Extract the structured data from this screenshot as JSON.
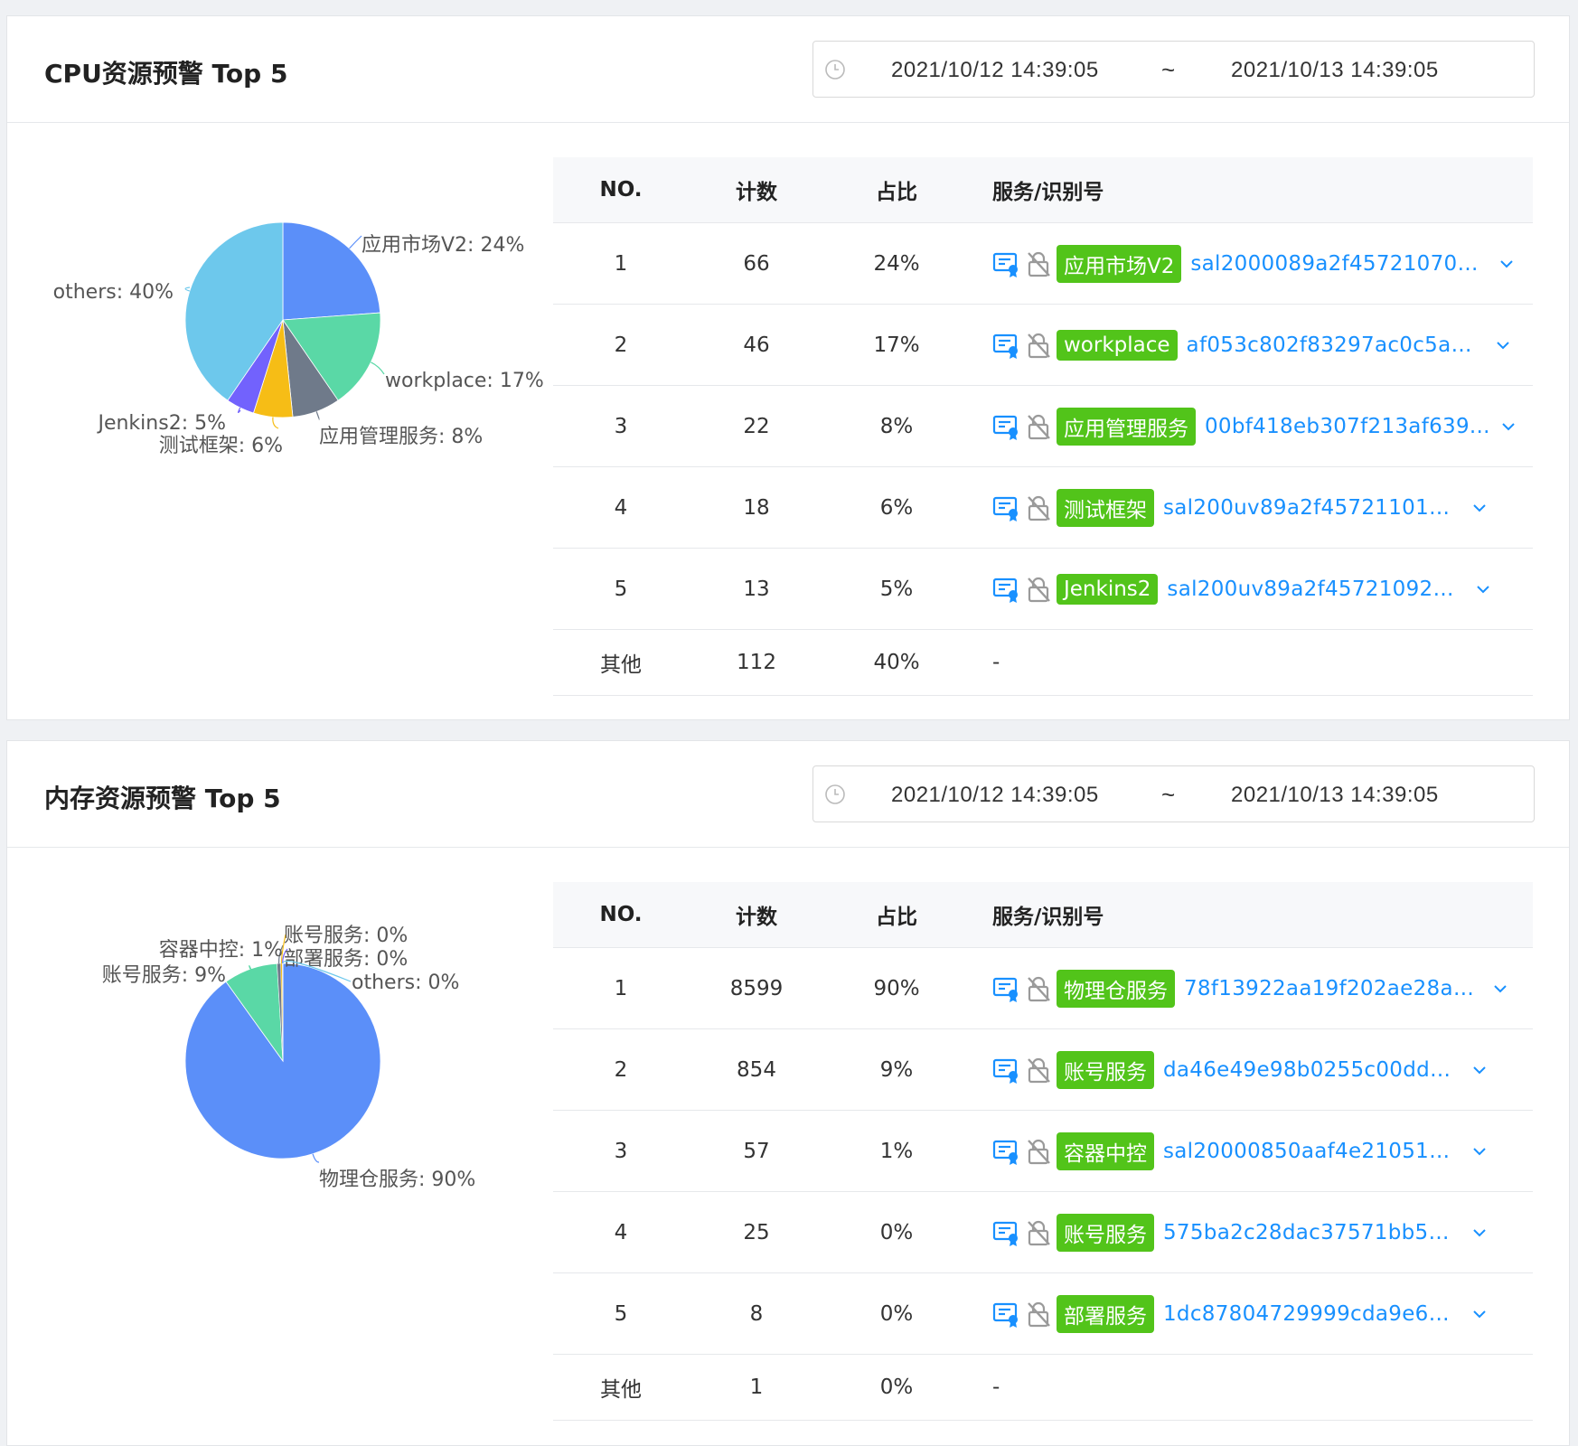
{
  "panels": [
    {
      "title": "CPU资源预警 Top 5",
      "date_start": "2021/10/12 14:39:05",
      "date_sep": "~",
      "date_end": "2021/10/13 14:39:05",
      "headers": [
        "NO.",
        "计数",
        "占比",
        "服务/识别号"
      ],
      "rows": [
        {
          "no": "1",
          "count": "66",
          "pct": "24%",
          "tag": "应用市场V2",
          "id": "sal2000089a2f457210707..."
        },
        {
          "no": "2",
          "count": "46",
          "pct": "17%",
          "tag": "workplace",
          "id": "af053c802f83297ac0c5ad8..."
        },
        {
          "no": "3",
          "count": "22",
          "pct": "8%",
          "tag": "应用管理服务",
          "id": "00bf418eb307f213af639..."
        },
        {
          "no": "4",
          "count": "18",
          "pct": "6%",
          "tag": "测试框架",
          "id": "sal200uv89a2f45721101261..."
        },
        {
          "no": "5",
          "count": "13",
          "pct": "5%",
          "tag": "Jenkins2",
          "id": "sal200uv89a2f45721092370..."
        }
      ],
      "other_row": {
        "no": "其他",
        "count": "112",
        "pct": "40%",
        "svc": "-"
      },
      "pie_labels": [
        "应用市场V2: 24%",
        "workplace: 17%",
        "应用管理服务: 8%",
        "测试框架: 6%",
        "Jenkins2: 5%",
        "others: 40%"
      ]
    },
    {
      "title": "内存资源预警 Top 5",
      "date_start": "2021/10/12 14:39:05",
      "date_sep": "~",
      "date_end": "2021/10/13 14:39:05",
      "headers": [
        "NO.",
        "计数",
        "占比",
        "服务/识别号"
      ],
      "rows": [
        {
          "no": "1",
          "count": "8599",
          "pct": "90%",
          "tag": "物理仓服务",
          "id": "78f13922aa19f202ae28a3..."
        },
        {
          "no": "2",
          "count": "854",
          "pct": "9%",
          "tag": "账号服务",
          "id": "da46e49e98b0255c00dd64fd..."
        },
        {
          "no": "3",
          "count": "57",
          "pct": "1%",
          "tag": "容器中控",
          "id": "sal20000850aaf4e210512eae..."
        },
        {
          "no": "4",
          "count": "25",
          "pct": "0%",
          "tag": "账号服务",
          "id": "575ba2c28dac37571bb57e4..."
        },
        {
          "no": "5",
          "count": "8",
          "pct": "0%",
          "tag": "部署服务",
          "id": "1dc87804729999cda9e62f8e..."
        }
      ],
      "other_row": {
        "no": "其他",
        "count": "1",
        "pct": "0%",
        "svc": "-"
      },
      "pie_labels": [
        "物理仓服务: 90%",
        "账号服务: 9%",
        "容器中控: 1%",
        "账号服务: 0%",
        "部署服务: 0%",
        "others: 0%"
      ]
    }
  ],
  "chart_data": [
    {
      "type": "pie",
      "categories": [
        "应用市场V2",
        "workplace",
        "应用管理服务",
        "测试框架",
        "Jenkins2",
        "others"
      ],
      "values": [
        66,
        46,
        22,
        18,
        13,
        112
      ],
      "colors": [
        "#5b8ff9",
        "#5ad8a6",
        "#6f7a8a",
        "#f6bd16",
        "#7262fd",
        "#6dc8ec"
      ]
    },
    {
      "type": "pie",
      "categories": [
        "物理仓服务",
        "账号服务",
        "容器中控",
        "账号服务",
        "部署服务",
        "others"
      ],
      "values": [
        8599,
        854,
        57,
        25,
        8,
        1
      ],
      "colors": [
        "#5b8ff9",
        "#5ad8a6",
        "#6f7a8a",
        "#f6bd16",
        "#7262fd",
        "#6dc8ec"
      ]
    }
  ]
}
